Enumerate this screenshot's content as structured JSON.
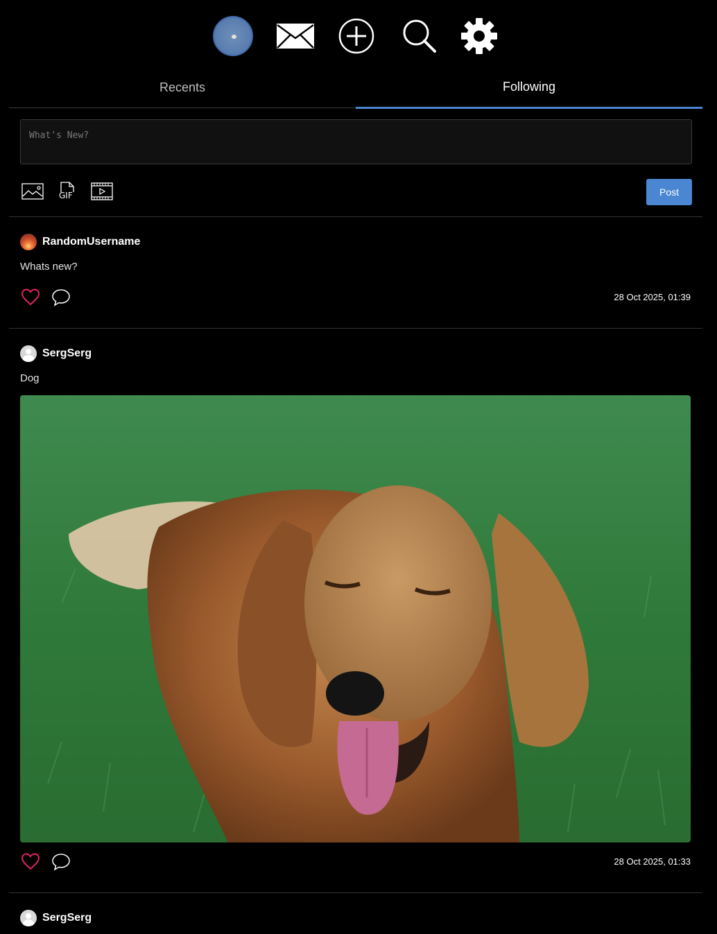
{
  "nav": {
    "icons": [
      "profile-avatar",
      "mail-icon",
      "plus-circle-icon",
      "search-icon",
      "gear-icon"
    ]
  },
  "tabs": [
    {
      "label": "Recents",
      "active": false
    },
    {
      "label": "Following",
      "active": true
    }
  ],
  "composer": {
    "placeholder": "What's New?",
    "value": "",
    "media_buttons": [
      "image-icon",
      "gif-icon",
      "video-icon"
    ],
    "gif_label": "GIF",
    "post_label": "Post"
  },
  "colors": {
    "accent": "#4a86d1",
    "like": "#e0245e",
    "background": "#000000"
  },
  "posts": [
    {
      "username": "RandomUsername",
      "avatar": "sunset-avatar",
      "text": "Whats new?",
      "timestamp": "28 Oct 2025, 01:39"
    },
    {
      "username": "SergSerg",
      "avatar": "default-avatar",
      "text": "Dog",
      "image": "dog-photo",
      "timestamp": "28 Oct 2025, 01:33"
    },
    {
      "username": "SergSerg",
      "avatar": "default-avatar"
    }
  ]
}
